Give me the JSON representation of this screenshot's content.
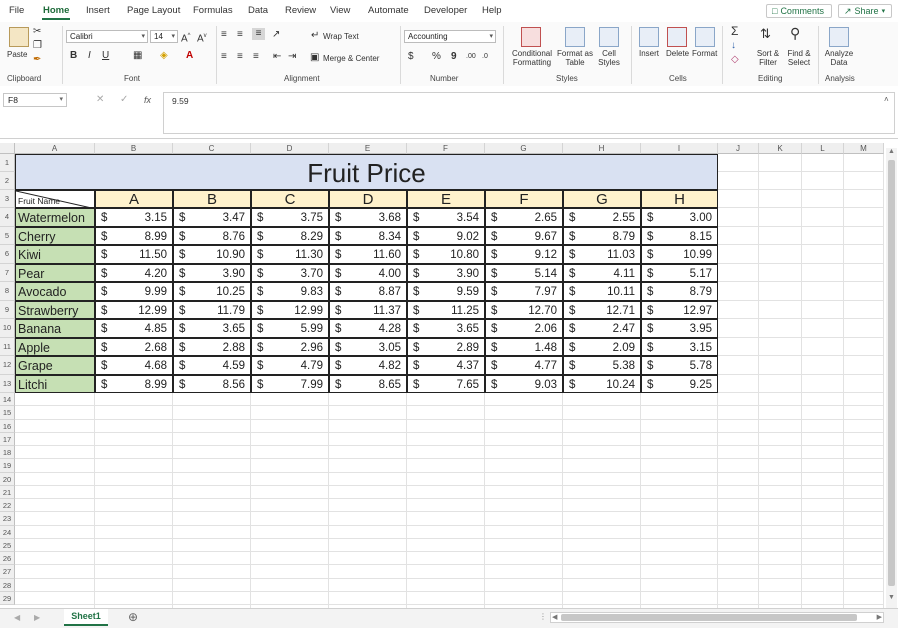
{
  "menu": {
    "items": [
      "File",
      "Home",
      "Insert",
      "Page Layout",
      "Formulas",
      "Data",
      "Review",
      "View",
      "Automate",
      "Developer",
      "Help"
    ],
    "active": "Home",
    "comments_label": "Comments",
    "share_label": "Share"
  },
  "ribbon": {
    "clipboard": {
      "paste_label": "Paste",
      "group_label": "Clipboard"
    },
    "font": {
      "font_name": "Calibri",
      "font_size": "14",
      "group_label": "Font",
      "bold": "B",
      "italic": "I",
      "underline": "U"
    },
    "alignment": {
      "wrap_text": "Wrap Text",
      "merge_center": "Merge & Center",
      "group_label": "Alignment"
    },
    "number": {
      "format": "Accounting",
      "dollar": "$",
      "percent": "%",
      "comma": "9",
      "group_label": "Number"
    },
    "styles": {
      "conditional_formatting": "Conditional Formatting",
      "format_as_table": "Format as Table",
      "cell_styles": "Cell Styles",
      "group_label": "Styles"
    },
    "cells": {
      "insert": "Insert",
      "delete": "Delete",
      "format": "Format",
      "group_label": "Cells"
    },
    "editing": {
      "sort_filter": "Sort & Filter",
      "find_select": "Find & Select",
      "group_label": "Editing"
    },
    "analysis": {
      "analyze_data": "Analyze Data",
      "group_label": "Analysis"
    }
  },
  "formula_bar": {
    "name_box": "F8",
    "fx": "fx",
    "value": "9.59"
  },
  "sheet": {
    "columns": [
      "A",
      "B",
      "C",
      "D",
      "E",
      "F",
      "G",
      "H",
      "I",
      "J",
      "K",
      "L",
      "M"
    ],
    "rows": [
      "1",
      "2",
      "3",
      "4",
      "5",
      "6",
      "7",
      "8",
      "9",
      "10",
      "11",
      "12",
      "13",
      "14",
      "15",
      "16",
      "17",
      "18",
      "19",
      "20",
      "21",
      "22",
      "23",
      "24",
      "25",
      "26",
      "27",
      "28",
      "29"
    ],
    "title": "Fruit Price",
    "corner_label": "Fruit Name",
    "headers": [
      "A",
      "B",
      "C",
      "D",
      "E",
      "F",
      "G",
      "H"
    ],
    "currency": "$",
    "data": [
      {
        "fruit": "Watermelon",
        "prices": [
          "3.15",
          "3.47",
          "3.75",
          "3.68",
          "3.54",
          "2.65",
          "2.55",
          "3.00"
        ]
      },
      {
        "fruit": "Cherry",
        "prices": [
          "8.99",
          "8.76",
          "8.29",
          "8.34",
          "9.02",
          "9.67",
          "8.79",
          "8.15"
        ]
      },
      {
        "fruit": "Kiwi",
        "prices": [
          "11.50",
          "10.90",
          "11.30",
          "11.60",
          "10.80",
          "9.12",
          "11.03",
          "10.99"
        ]
      },
      {
        "fruit": "Pear",
        "prices": [
          "4.20",
          "3.90",
          "3.70",
          "4.00",
          "3.90",
          "5.14",
          "4.11",
          "5.17"
        ]
      },
      {
        "fruit": "Avocado",
        "prices": [
          "9.99",
          "10.25",
          "9.83",
          "8.87",
          "9.59",
          "7.97",
          "10.11",
          "8.79"
        ]
      },
      {
        "fruit": "Strawberry",
        "prices": [
          "12.99",
          "11.79",
          "12.99",
          "11.37",
          "11.25",
          "12.70",
          "12.71",
          "12.97"
        ]
      },
      {
        "fruit": "Banana",
        "prices": [
          "4.85",
          "3.65",
          "5.99",
          "4.28",
          "3.65",
          "2.06",
          "2.47",
          "3.95"
        ]
      },
      {
        "fruit": "Apple",
        "prices": [
          "2.68",
          "2.88",
          "2.96",
          "3.05",
          "2.89",
          "1.48",
          "2.09",
          "3.15"
        ]
      },
      {
        "fruit": "Grape",
        "prices": [
          "4.68",
          "4.59",
          "4.79",
          "4.82",
          "4.37",
          "4.77",
          "5.38",
          "5.78"
        ]
      },
      {
        "fruit": "Litchi",
        "prices": [
          "8.99",
          "8.56",
          "7.99",
          "8.65",
          "7.65",
          "9.03",
          "10.24",
          "9.25"
        ]
      }
    ]
  },
  "tabs": {
    "active": "Sheet1"
  },
  "colors": {
    "title_fill": "#d9e1f2",
    "header_fill": "#fff2cc",
    "fruit_fill": "#c6e0b4",
    "accent": "#217346"
  }
}
